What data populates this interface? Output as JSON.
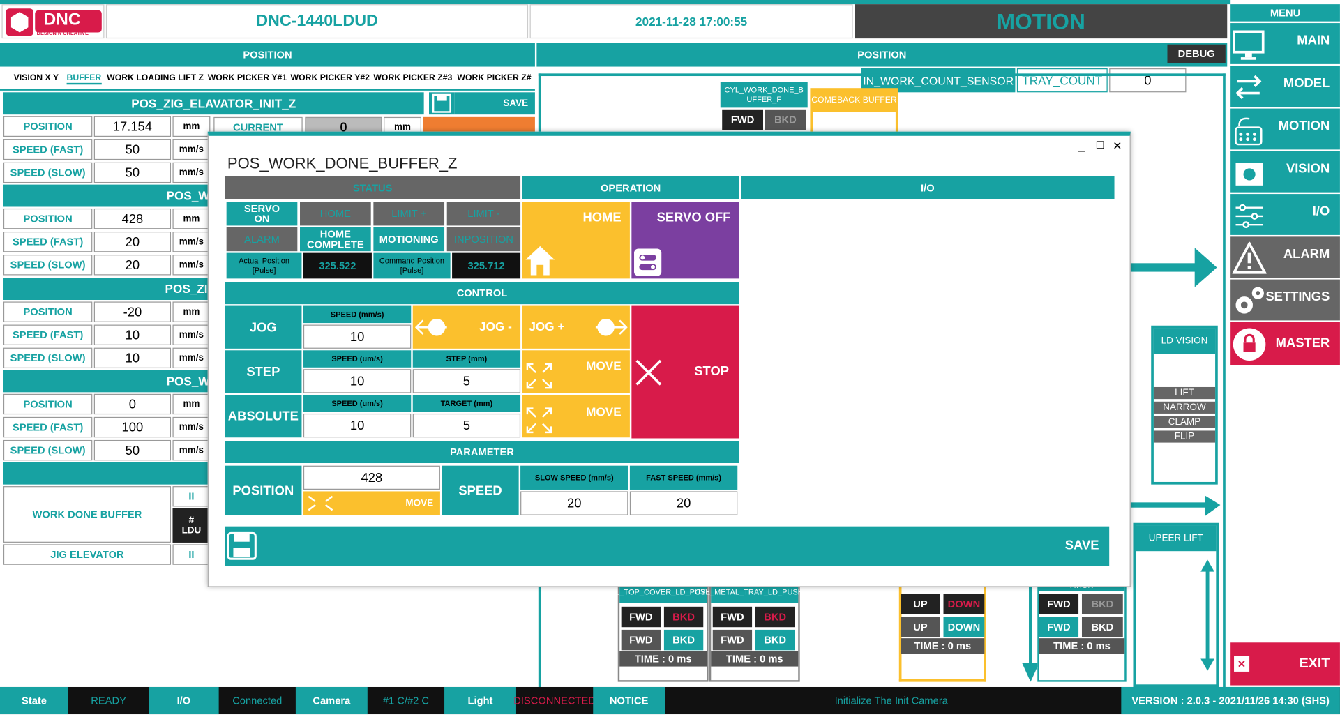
{
  "header": {
    "logo_text": "DNC",
    "logo_sub": "DESIGN N CREATIVE",
    "model": "DNC-1440LDUD",
    "datetime": "2021-11-28 17:00:55",
    "page": "MOTION",
    "menu": "MENU"
  },
  "left": {
    "title": "POSITION",
    "tabs": [
      "VISION X Y",
      "BUFFER",
      "WORK LOADING LIFT Z",
      "WORK PICKER Y#1",
      "WORK PICKER Y#2",
      "WORK PICKER Z#3",
      "WORK PICKER Z#"
    ],
    "groups": [
      {
        "title": "POS_ZIG_ELAVATOR_INIT_Z",
        "position": "17.154",
        "fast": "50",
        "slow": "50"
      },
      {
        "title": "POS_WORK_DO",
        "position": "428",
        "fast": "20",
        "slow": "20"
      },
      {
        "title": "POS_ZIG_ELAVA",
        "position": "-20",
        "fast": "10",
        "slow": "10"
      },
      {
        "title": "POS_WORK_DO",
        "position": "0",
        "fast": "100",
        "slow": "50"
      }
    ],
    "labels": {
      "position": "POSITION",
      "fast": "SPEED (FAST)",
      "slow": "SPEED (SLOW)",
      "mm": "mm",
      "mms": "mm/s",
      "current": "CURRENT",
      "current_val": "0",
      "save": "SAVE"
    },
    "bottom": {
      "work_done": "WORK DONE BUFFER",
      "jig": "JIG ELEVATOR",
      "ii": "II",
      "ldu": "LDU",
      "hash": "#"
    }
  },
  "right": {
    "title": "POSITION",
    "debug": "DEBUG",
    "sensor": "IN_WORK_COUNT_SENSOR",
    "tray_label": "TRAY_COUNT",
    "tray_val": "0",
    "cyl_buffer": "CYL_WORK_DONE_BUFFER_F",
    "comeback": "COMEBACK BUFFER",
    "fwd": "FWD",
    "bkd": "BKD",
    "ld_vision": "LD VISION",
    "ld_items": [
      "LIFT",
      "NARROW",
      "CLAMP",
      "FLIP"
    ],
    "upper_lift": "UPEER LIFT",
    "cyl_top": "CYL_TOP_COVER_LD_PUSHER",
    "cyl_metal": "CYL_METAL_TRAY_LD_PUSHER",
    "ation": "ATION",
    "up": "UP",
    "down": "DOWN",
    "time": "TIME : 0 ms"
  },
  "menu": [
    {
      "label": "MAIN",
      "icon": "monitor-icon"
    },
    {
      "label": "MODEL",
      "icon": "swap-icon"
    },
    {
      "label": "MOTION",
      "icon": "motion-icon"
    },
    {
      "label": "VISION",
      "icon": "vision-icon"
    },
    {
      "label": "I/O",
      "icon": "io-icon"
    },
    {
      "label": "ALARM",
      "icon": "alarm-icon"
    },
    {
      "label": "SETTINGS",
      "icon": "settings-icon"
    },
    {
      "label": "MASTER",
      "icon": "lock-icon"
    }
  ],
  "exit": "EXIT",
  "dialog": {
    "title": "POS_WORK_DONE_BUFFER_Z",
    "status": "STATUS",
    "operation": "OPERATION",
    "io": "I/O",
    "servo_on": "SERVO ON",
    "home": "HOME",
    "limit_p": "LIMIT +",
    "limit_m": "LIMIT -",
    "alarm": "ALARM",
    "home_complete": "HOME COMPLETE",
    "motioning": "MOTIONING",
    "inposition": "INPOSITION",
    "actual_label": "Actual Position [Pulse]",
    "actual_val": "325.522",
    "command_label": "Command Position [Pulse]",
    "command_val": "325.712",
    "op_home": "HOME",
    "op_servo_off": "SERVO OFF",
    "control": "CONTROL",
    "jog": "JOG",
    "step": "STEP",
    "absolute": "ABSOLUTE",
    "speed_mms": "SPEED (mm/s)",
    "speed_ums": "SPEED (um/s)",
    "step_mm": "STEP (mm)",
    "target_mm": "TARGET (mm)",
    "jog_speed": "10",
    "step_speed": "10",
    "step_val": "5",
    "abs_speed": "10",
    "abs_target": "5",
    "jog_minus": "JOG -",
    "jog_plus": "JOG +",
    "move": "MOVE",
    "stop": "STOP",
    "parameter": "PARAMETER",
    "position": "POSITION",
    "position_val": "428",
    "speed": "SPEED",
    "slow_speed": "SLOW SPEED (mm/s)",
    "fast_speed": "FAST SPEED (mm/s)",
    "slow_val": "20",
    "fast_val": "20",
    "save": "SAVE"
  },
  "status": {
    "state": "State",
    "ready": "READY",
    "io": "I/O",
    "connected": "Connected",
    "camera": "Camera",
    "cam_val": "#1 C/#2 C",
    "light": "Light",
    "disconnected": "DISCONNECTED",
    "notice": "NOTICE",
    "message": "Initialize The Init Camera",
    "version": "VERSION : 2.0.3 - 2021/11/26 14:30 (SHS)"
  },
  "colors": {
    "teal": "#17a2a2",
    "yellow": "#fbc02d",
    "purple": "#7b3fa0",
    "red": "#d81b4a",
    "dark": "#1a1a1a",
    "gray": "#666666"
  }
}
